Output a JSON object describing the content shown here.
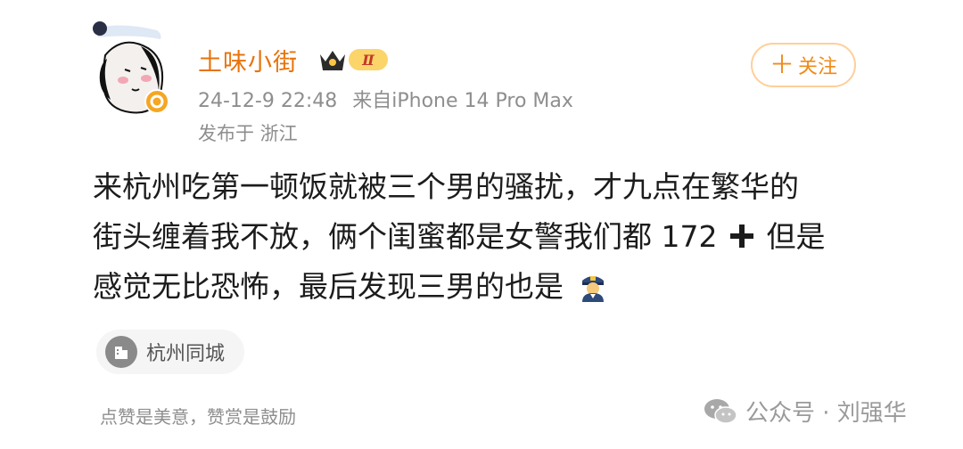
{
  "post": {
    "username": "土味小街",
    "badge_level": "Ⅱ",
    "timestamp": "24-12-9 22:48",
    "source": "来自iPhone 14 Pro Max",
    "location": "发布于 浙江",
    "follow_label": "关注",
    "text_lines": [
      "来杭州吃第一顿饭就被三个男的骚扰，才九点在繁华的",
      "街头缠着我不放，俩个闺蜜都是女警我们都 172",
      "但是",
      "感觉无比恐怖，最后发现三男的也是"
    ],
    "topic": "杭州同城",
    "footer_note": "点赞是美意，赞赏是鼓励"
  },
  "watermark": {
    "text": "公众号 · 刘强华"
  },
  "colors": {
    "username": "#e8730b",
    "follow_border": "#ffcf9a",
    "meta_gray": "#8e8e8e"
  },
  "icons": [
    "avatar-image",
    "verified-icon",
    "crown-badge-icon",
    "plus-icon",
    "heavy-plus-icon",
    "police-officer-emoji-icon",
    "building-icon",
    "wechat-icon"
  ]
}
